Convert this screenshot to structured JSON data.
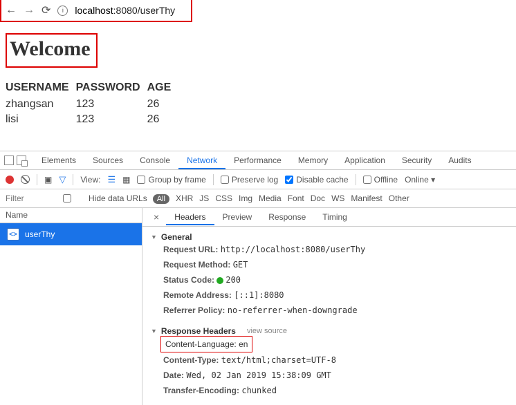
{
  "browser": {
    "url_host": "localhost",
    "url_port_path": ":8080/userThy"
  },
  "page": {
    "heading": "Welcome",
    "columns": [
      "USERNAME",
      "PASSWORD",
      "AGE"
    ],
    "rows": [
      {
        "username": "zhangsan",
        "password": "123",
        "age": "26"
      },
      {
        "username": "lisi",
        "password": "123",
        "age": "26"
      }
    ]
  },
  "devtools": {
    "tabs": [
      "Elements",
      "Sources",
      "Console",
      "Network",
      "Performance",
      "Memory",
      "Application",
      "Security",
      "Audits"
    ],
    "active_tab": "Network",
    "toolbar": {
      "view_label": "View:",
      "group_by_frame": "Group by frame",
      "preserve_log": "Preserve log",
      "disable_cache": "Disable cache",
      "offline": "Offline",
      "online": "Online"
    },
    "filter": {
      "placeholder": "Filter",
      "hide_data_urls": "Hide data URLs",
      "types": [
        "All",
        "XHR",
        "JS",
        "CSS",
        "Img",
        "Media",
        "Font",
        "Doc",
        "WS",
        "Manifest",
        "Other"
      ]
    },
    "left": {
      "name_label": "Name",
      "request": "userThy"
    },
    "right_tabs": [
      "Headers",
      "Preview",
      "Response",
      "Timing"
    ],
    "headers": {
      "general_title": "General",
      "general": [
        {
          "k": "Request URL:",
          "v": "http://localhost:8080/userThy"
        },
        {
          "k": "Request Method:",
          "v": "GET"
        },
        {
          "k": "Status Code:",
          "v": "200",
          "status": true
        },
        {
          "k": "Remote Address:",
          "v": "[::1]:8080"
        },
        {
          "k": "Referrer Policy:",
          "v": "no-referrer-when-downgrade"
        }
      ],
      "response_title": "Response Headers",
      "view_source": "view source",
      "response": [
        {
          "k": "Content-Language:",
          "v": "en",
          "highlight": true
        },
        {
          "k": "Content-Type:",
          "v": "text/html;charset=UTF-8"
        },
        {
          "k": "Date:",
          "v": "Wed, 02 Jan 2019 15:38:09 GMT"
        },
        {
          "k": "Transfer-Encoding:",
          "v": "chunked"
        }
      ]
    }
  }
}
